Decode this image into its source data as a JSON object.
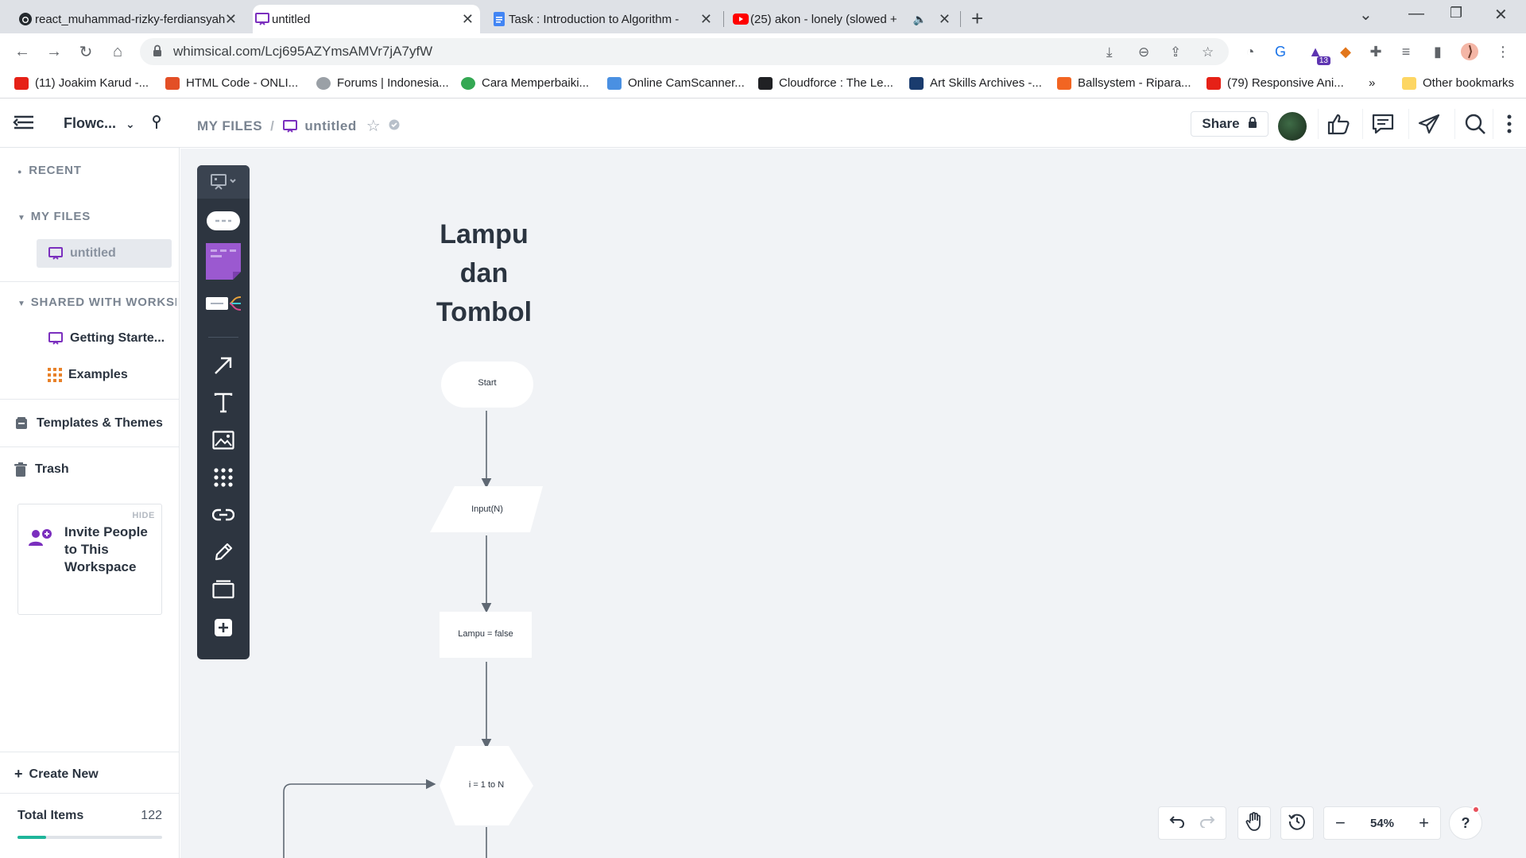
{
  "browser": {
    "tabs": [
      {
        "title": "react_muhammad-rizky-ferdiansyah",
        "icon": "github-icon"
      },
      {
        "title": "untitled",
        "icon": "whimsical-board-icon"
      },
      {
        "title": "Task : Introduction to Algorithm -",
        "icon": "google-docs-icon"
      },
      {
        "title": "(25) akon - lonely (slowed +",
        "icon": "youtube-icon"
      }
    ],
    "url": "whimsical.com/Lcj695AZYmsAMVr7jA7yfW",
    "extension_badge": "13",
    "bookmarks": [
      {
        "label": "(11) Joakim Karud -...",
        "color": "#e62117"
      },
      {
        "label": "HTML Code - ONLI...",
        "color": "#e34f26"
      },
      {
        "label": "Forums | Indonesia...",
        "color": "#9aa0a6"
      },
      {
        "label": "Cara Memperbaiki...",
        "color": "#34a853"
      },
      {
        "label": "Online CamScanner...",
        "color": "#4a90e2"
      },
      {
        "label": "Cloudforce : The Le...",
        "color": "#202124"
      },
      {
        "label": "Art Skills Archives -...",
        "color": "#1a3c6e"
      },
      {
        "label": "Ballsystem - Ripara...",
        "color": "#f26522"
      },
      {
        "label": "(79) Responsive Ani...",
        "color": "#e62117"
      }
    ],
    "more_bookmarks": "»",
    "other_bookmarks": "Other bookmarks"
  },
  "app": {
    "workspace_name": "Flowc...",
    "breadcrumb_root": "MY FILES",
    "breadcrumb_sep": "/",
    "breadcrumb_file": "untitled",
    "share_label": "Share"
  },
  "sidebar": {
    "recent": "RECENT",
    "my_files": "MY FILES",
    "my_files_items": [
      {
        "label": "untitled"
      }
    ],
    "shared": "SHARED WITH WORKSPACE",
    "shared_items": [
      {
        "label": "Getting Starte..."
      },
      {
        "label": "Examples"
      }
    ],
    "templates": "Templates & Themes",
    "trash": "Trash",
    "invite_hide": "HIDE",
    "invite_text": "Invite People to This Workspace",
    "create_new": "Create New",
    "total_label": "Total Items",
    "total_value": "122",
    "usage_fraction": 0.2
  },
  "canvas": {
    "title_lines": [
      "Lampu",
      "dan",
      "Tombol"
    ],
    "nodes": [
      {
        "type": "terminal",
        "text": "Start"
      },
      {
        "type": "input",
        "text": "Input(N)"
      },
      {
        "type": "process",
        "text": "Lampu = false"
      },
      {
        "type": "loop",
        "text": "i = 1 to N"
      }
    ]
  },
  "controls": {
    "zoom": "54%",
    "help": "?"
  }
}
